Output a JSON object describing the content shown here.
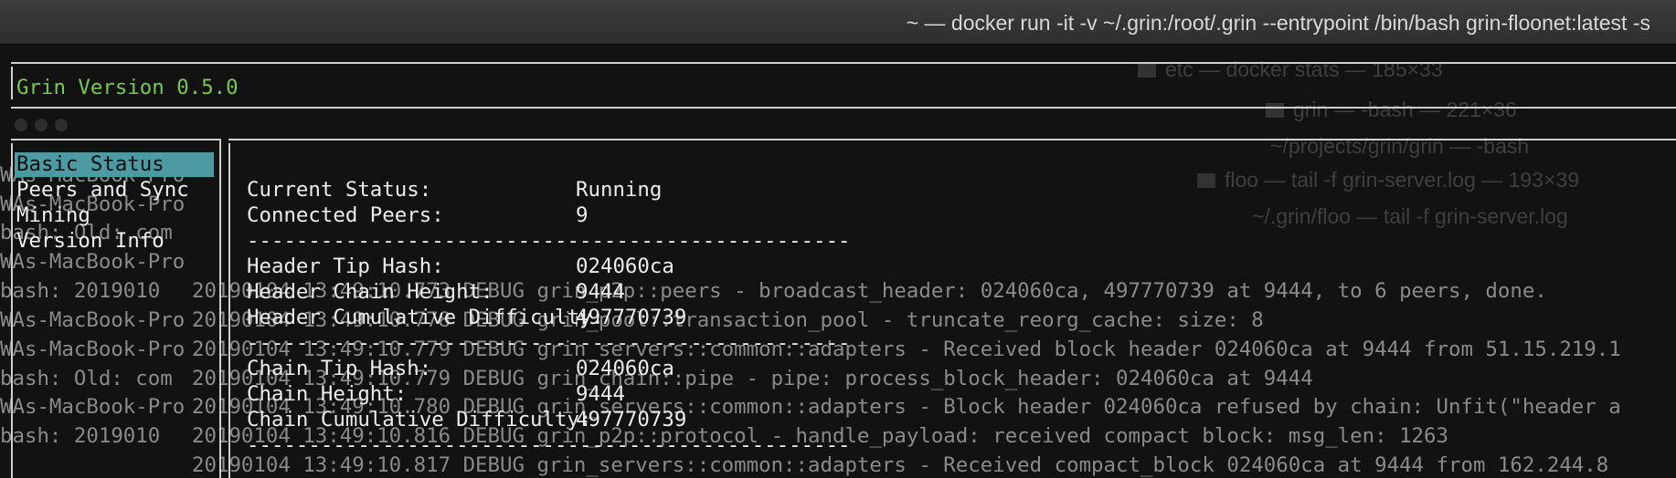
{
  "window": {
    "title": "~ — docker run -it -v ~/.grin:/root/.grin --entrypoint /bin/bash grin-floonet:latest -s"
  },
  "ghost_windows": [
    "etc — docker stats — 185×33",
    "grin — -bash — 221×36",
    "~/projects/grin/grin — -bash",
    "floo — tail -f grin-server.log — 193×39",
    "~/.grin/floo — tail -f grin-server.log"
  ],
  "background_left": [
    "WAs-MacBook-Pro",
    "WAs-MacBook-Pro",
    "bash: Old: com",
    "WAs-MacBook-Pro",
    "bash: 2019010",
    "WAs-MacBook-Pro",
    "WAs-MacBook-Pro",
    "bash: Old: com",
    "WAs-MacBook-Pro",
    "bash: 2019010"
  ],
  "background_log": [
    "20190104 13:49:10.773 DEBUG grin_p2p::peers - broadcast_header: 024060ca, 497770739 at 9444, to 6 peers, done.",
    "20190104 13:49:10.778 DEBUG grin_pool::transaction_pool - truncate_reorg_cache: size: 8",
    "20190104 13:49:10.779 DEBUG grin_servers::common::adapters - Received block header 024060ca at 9444 from 51.15.219.1",
    "20190104 13:49:10.779 DEBUG grin_chain::pipe - pipe: process_block_header: 024060ca at 9444",
    "20190104 13:49:10.780 DEBUG grin_servers::common::adapters - Block header 024060ca refused by chain: Unfit(\"header a",
    "20190104 13:49:10.816 DEBUG grin_p2p::protocol - handle_payload: received compact block: msg_len: 1263",
    "20190104 13:49:10.817 DEBUG grin_servers::common::adapters - Received compact_block 024060ca at 9444 from 162.244.8"
  ],
  "app": {
    "version": "Grin Version 0.5.0",
    "menu": [
      "Basic Status",
      "Peers and Sync",
      "Mining",
      "Version Info"
    ],
    "status": {
      "current_status_label": "Current Status:",
      "current_status_value": "Running",
      "connected_peers_label": "Connected Peers:",
      "connected_peers_value": "9",
      "header_tip_hash_label": "Header Tip Hash:",
      "header_tip_hash_value": "024060ca",
      "header_chain_height_label": "Header Chain Height:",
      "header_chain_height_value": "9444",
      "header_cumulative_difficulty_label": "Header Cumulative Difficulty:",
      "header_cumulative_difficulty_value": "497770739",
      "chain_tip_hash_label": "Chain Tip Hash:",
      "chain_tip_hash_value": "024060ca",
      "chain_height_label": "Chain Height:",
      "chain_height_value": "9444",
      "chain_cumulative_difficulty_label": "Chain Cumulative Difficulty:",
      "chain_cumulative_difficulty_value": "497770739",
      "separator": "-------------------------------------------------"
    }
  },
  "colors": {
    "accent_green": "#78c84e",
    "selection": "#4c9aa3"
  }
}
